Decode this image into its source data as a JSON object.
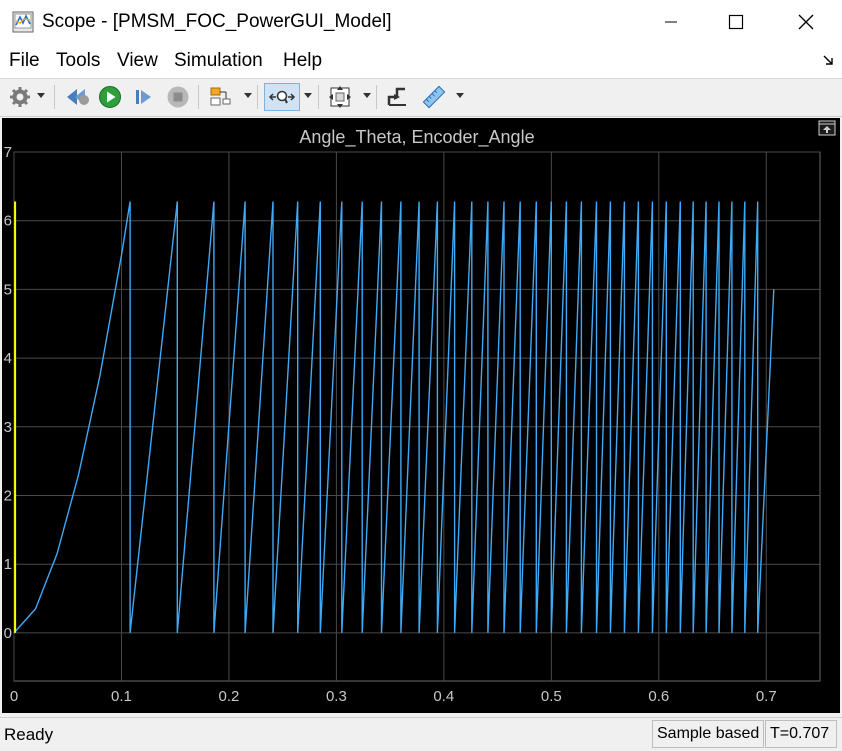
{
  "window": {
    "title": "Scope - [PMSM_FOC_PowerGUI_Model]"
  },
  "menu": {
    "items": [
      "File",
      "Tools",
      "View",
      "Simulation",
      "Help"
    ]
  },
  "toolbar": {
    "buttons": [
      {
        "name": "settings",
        "icon": "gear-icon",
        "dropdown": true
      },
      {
        "name": "step-back",
        "icon": "step-back-icon"
      },
      {
        "name": "run",
        "icon": "run-icon"
      },
      {
        "name": "step-forward",
        "icon": "step-forward-icon"
      },
      {
        "name": "stop",
        "icon": "stop-icon"
      },
      {
        "name": "layout",
        "icon": "layout-icon",
        "dropdown": true
      },
      {
        "name": "zoom",
        "icon": "zoom-icon",
        "dropdown": true,
        "active": true
      },
      {
        "name": "autoscale",
        "icon": "autoscale-icon",
        "dropdown": true
      },
      {
        "name": "triggers",
        "icon": "trigger-icon"
      },
      {
        "name": "measurements",
        "icon": "ruler-icon",
        "dropdown": true
      }
    ]
  },
  "plot": {
    "undock_icon": "undock-icon"
  },
  "chart_data": {
    "type": "line",
    "title": "Angle_Theta, Encoder_Angle",
    "xlabel": "",
    "ylabel": "",
    "xlim": [
      0,
      0.75
    ],
    "ylim": [
      -0.7,
      7
    ],
    "x_ticks": [
      0,
      0.1,
      0.2,
      0.3,
      0.4,
      0.5,
      0.6,
      0.7
    ],
    "x_tick_labels": [
      "0",
      "0.1",
      "0.2",
      "0.3",
      "0.4",
      "0.5",
      "0.6",
      "0.7"
    ],
    "y_ticks": [
      0,
      1,
      2,
      3,
      4,
      5,
      6,
      7
    ],
    "y_tick_labels": [
      "0",
      "1",
      "2",
      "3",
      "4",
      "5",
      "6",
      "7"
    ],
    "grid": true,
    "background": "#000000",
    "grid_color": "#4a4a4a",
    "series": [
      {
        "color": "#3fa9f5",
        "style": "sawtooth",
        "start_curve": {
          "x": [
            0,
            0.02,
            0.04,
            0.06,
            0.08,
            0.1,
            0.108
          ],
          "y": [
            0,
            0.35,
            1.15,
            2.3,
            3.75,
            5.5,
            6.28
          ]
        },
        "wrap_times": [
          0.108,
          0.152,
          0.186,
          0.215,
          0.241,
          0.264,
          0.285,
          0.305,
          0.324,
          0.342,
          0.36,
          0.377,
          0.394,
          0.41,
          0.426,
          0.441,
          0.456,
          0.471,
          0.486,
          0.5,
          0.514,
          0.528,
          0.542,
          0.555,
          0.568,
          0.581,
          0.594,
          0.607,
          0.62,
          0.632,
          0.644,
          0.656,
          0.668,
          0.68,
          0.692
        ],
        "peak": 6.28,
        "end": {
          "x": 0.707,
          "y": 5.0
        }
      },
      {
        "color": "#ffff00",
        "style": "vertical",
        "x": 0.001,
        "y_range": [
          0,
          6.28
        ]
      }
    ]
  },
  "status": {
    "left": "Ready",
    "sample": "Sample based",
    "time": "T=0.707"
  }
}
